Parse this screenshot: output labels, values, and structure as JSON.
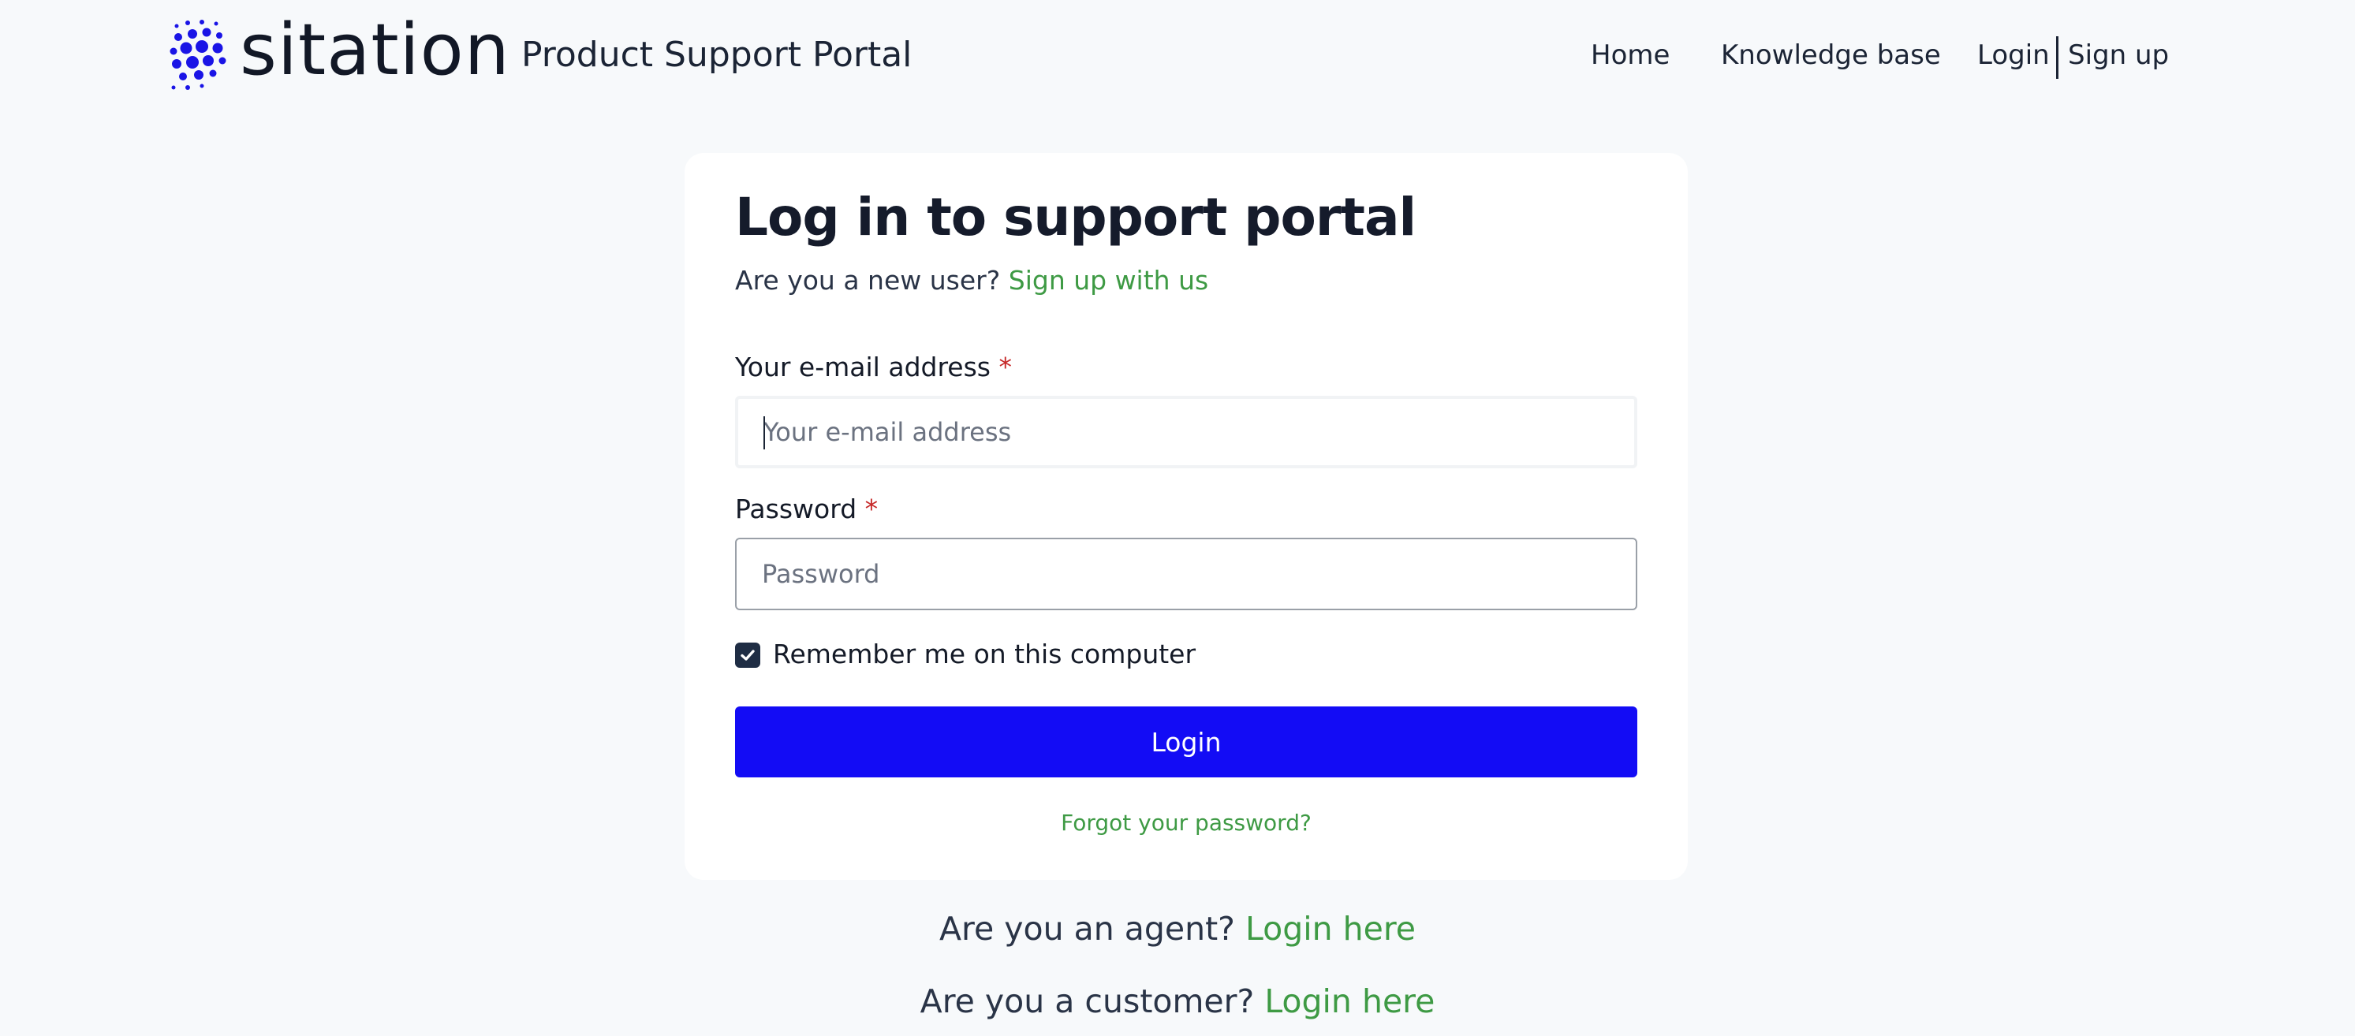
{
  "header": {
    "logo_text": "sitation",
    "portal_name": "Product Support Portal",
    "nav": {
      "home": "Home",
      "knowledge_base": "Knowledge base",
      "login": "Login",
      "signup": "Sign up"
    }
  },
  "login_card": {
    "title": "Log in to support portal",
    "new_user_text": "Are you a new user?",
    "signup_link": "Sign up with us",
    "email_label": "Your e-mail address",
    "email_placeholder": "Your e-mail address",
    "email_value": "",
    "password_label": "Password",
    "password_placeholder": "Password",
    "password_value": "",
    "required_marker": "*",
    "remember_label": "Remember me on this computer",
    "remember_checked": true,
    "login_button": "Login",
    "forgot_link": "Forgot your password?"
  },
  "footer": {
    "agent_text": "Are you an agent?",
    "agent_link": "Login here",
    "customer_text": "Are you a customer?",
    "customer_link": "Login here"
  },
  "colors": {
    "accent_blue": "#130cf5",
    "link_green": "#3e9a44",
    "required_red": "#c62828",
    "page_background": "#f7f9fb"
  },
  "icons": {
    "logo": "sitation-dots-logo-icon",
    "checkbox": "checkmark-icon"
  }
}
